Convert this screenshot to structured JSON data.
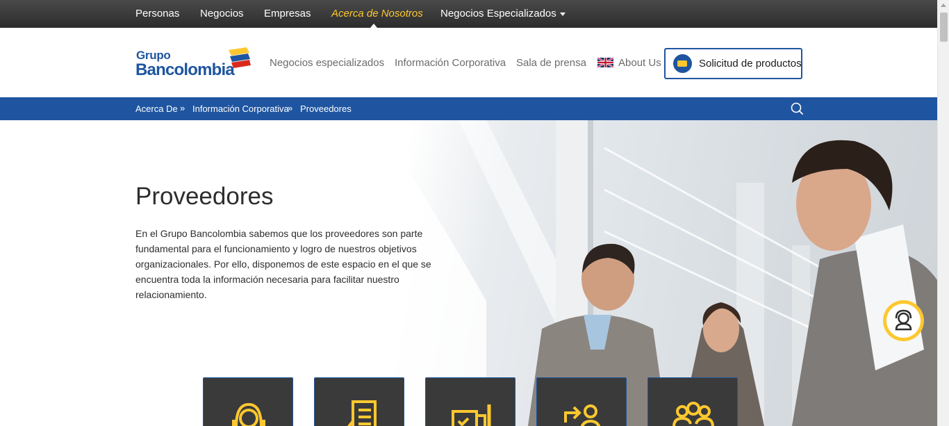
{
  "top_nav": {
    "items": [
      {
        "label": "Personas"
      },
      {
        "label": "Negocios"
      },
      {
        "label": "Empresas"
      },
      {
        "label": "Acerca de Nosotros",
        "active": true
      },
      {
        "label": "Negocios Especializados",
        "dropdown": true
      }
    ]
  },
  "header": {
    "logo": {
      "line1": "Grupo",
      "line2": "Bancolombia"
    },
    "nav": [
      {
        "label": "Negocios especializados"
      },
      {
        "label": "Información Corporativa"
      },
      {
        "label": "Sala de prensa"
      },
      {
        "label": "About Us",
        "icon": "uk-flag-icon"
      }
    ],
    "cta_label": "Solicitud de productos"
  },
  "breadcrumb": {
    "items": [
      "Acerca De",
      "Información Corporativa",
      "Proveedores"
    ],
    "separator": "»"
  },
  "hero": {
    "title": "Proveedores",
    "description": "En el Grupo Bancolombia sabemos que los proveedores son parte fundamental para el funcionamiento y logro de nuestros objetivos organizacionales. Por ello, disponemos de este espacio en el que se encuentra toda la información necesaria para facilitar nuestro relacionamiento."
  },
  "cards": [
    {
      "icon": "support-agent-icon"
    },
    {
      "icon": "invoice-icon"
    },
    {
      "icon": "documents-icon"
    },
    {
      "icon": "transfer-person-icon"
    },
    {
      "icon": "group-icon"
    }
  ],
  "colors": {
    "brand_blue": "#1f55a0",
    "brand_yellow": "#fdc82f",
    "brand_red": "#da291c",
    "topbar": "#333333",
    "card_bg": "#3a3a3a"
  }
}
